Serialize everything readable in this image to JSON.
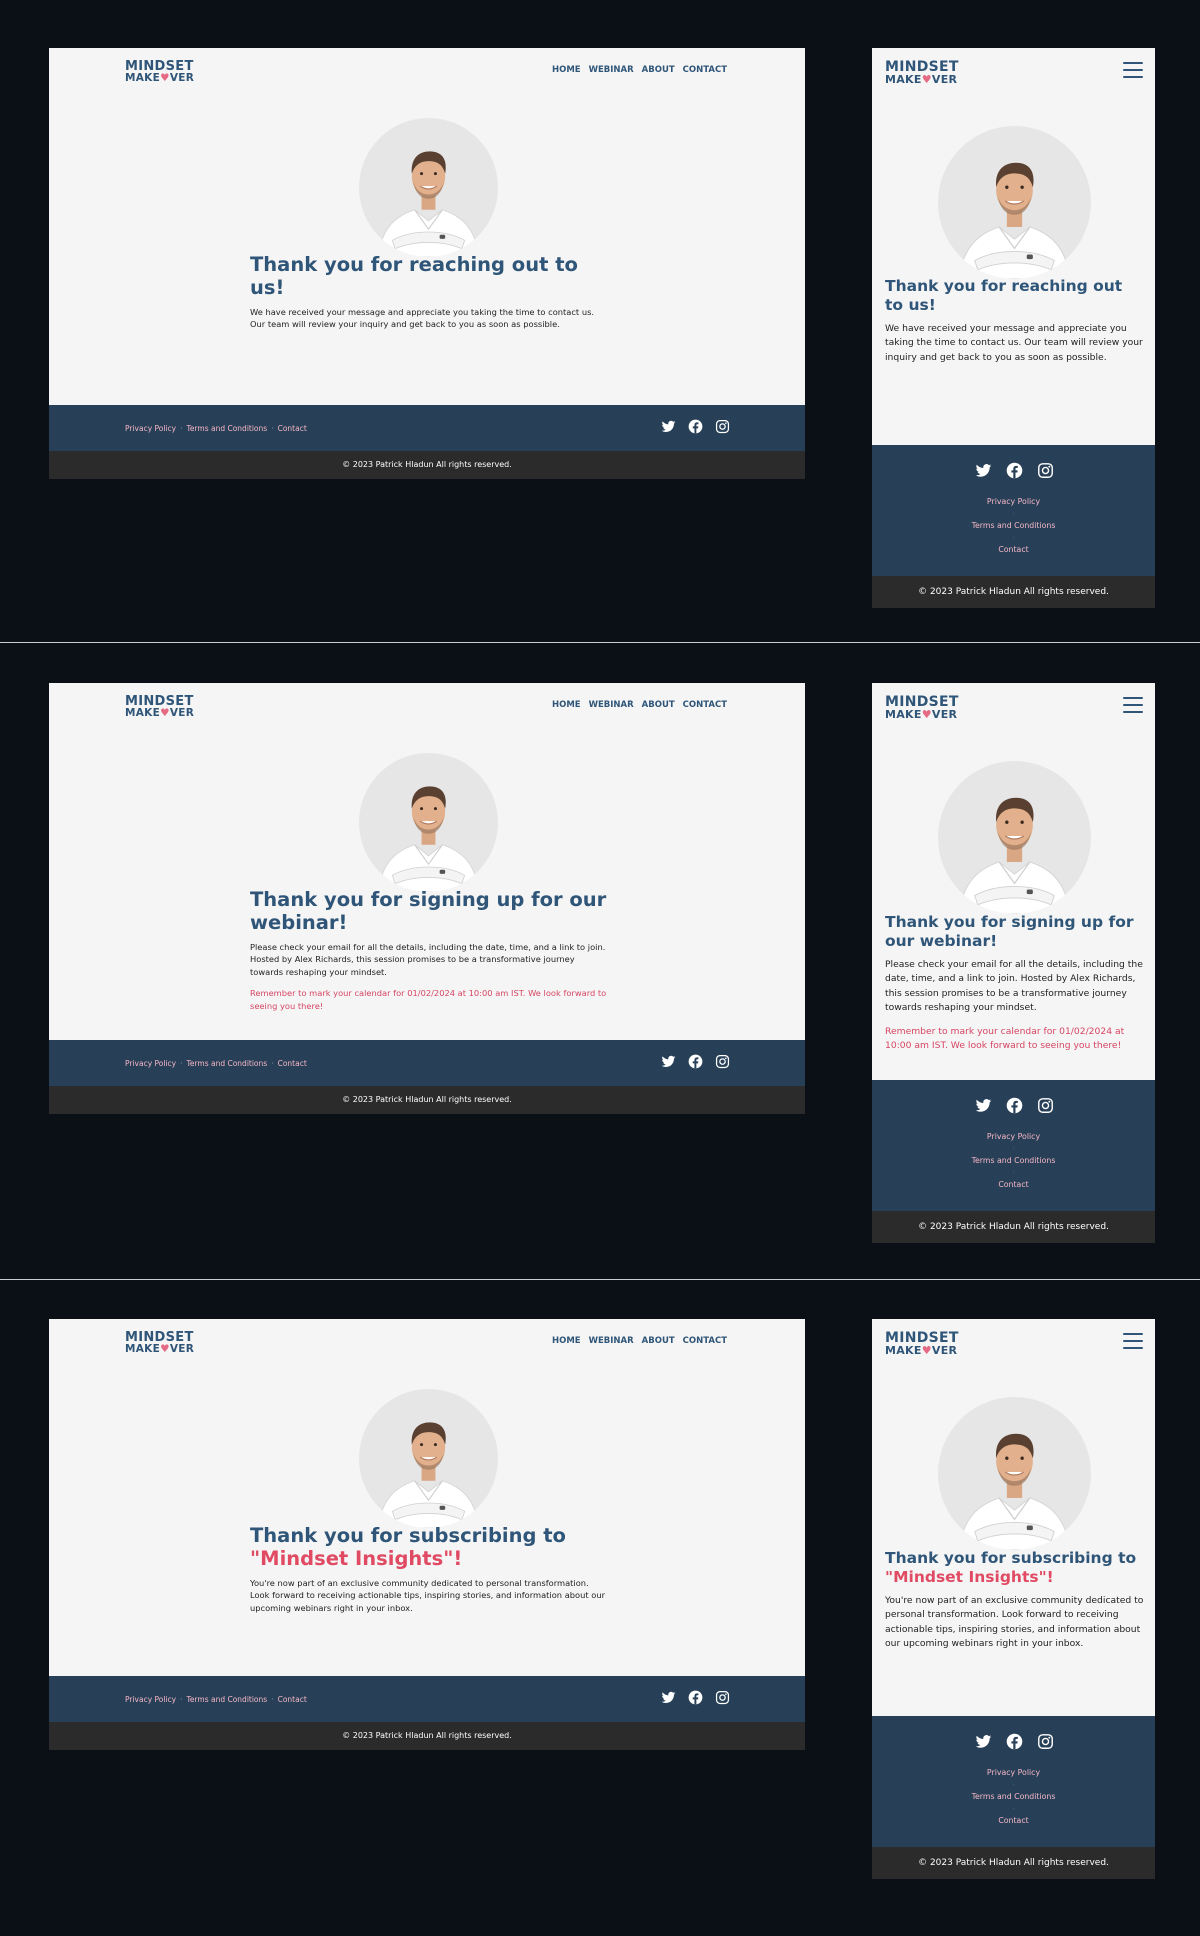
{
  "brand": {
    "line1": "MINDSET",
    "line2a": "MAKE",
    "line2b": "VER",
    "brain": "♥"
  },
  "nav": [
    "HOME",
    "WEBINAR",
    "ABOUT",
    "CONTACT"
  ],
  "footer": {
    "privacy": "Privacy Policy",
    "terms": "Terms and Conditions",
    "contact": "Contact",
    "separator": "·",
    "copyright": "© 2023 Patrick Hladun All rights reserved."
  },
  "icons": [
    "twitter-icon",
    "facebook-icon",
    "instagram-icon",
    "menu-icon"
  ],
  "colors": {
    "heading": "#2f5578",
    "accent": "#e04a63",
    "footer": "#274057",
    "copyright_bar": "#2b2b2b",
    "page_bg": "#0b0f16"
  },
  "pages": [
    {
      "heading": "Thank you for reaching out to us!",
      "heading_accent": "",
      "body": "We have received your message and appreciate you taking the time to contact us. Our team will review your inquiry and get back to you as soon as possible.",
      "reminder": ""
    },
    {
      "heading": "Thank you for signing up for our webinar!",
      "heading_accent": "",
      "body": "Please check your email for all the details, including the date, time, and a link to join. Hosted by Alex Richards, this session promises to be a transformative journey towards reshaping your mindset.",
      "reminder": "Remember to mark your calendar for 01/02/2024 at 10:00 am IST. We look forward to seeing you there!"
    },
    {
      "heading": "Thank you for subscribing to",
      "heading_accent": "\"Mindset Insights\"!",
      "body": "You're now part of an exclusive community dedicated to personal transformation. Look forward to receiving actionable tips, inspiring stories, and information about our upcoming webinars right in your inbox.",
      "reminder": ""
    }
  ]
}
